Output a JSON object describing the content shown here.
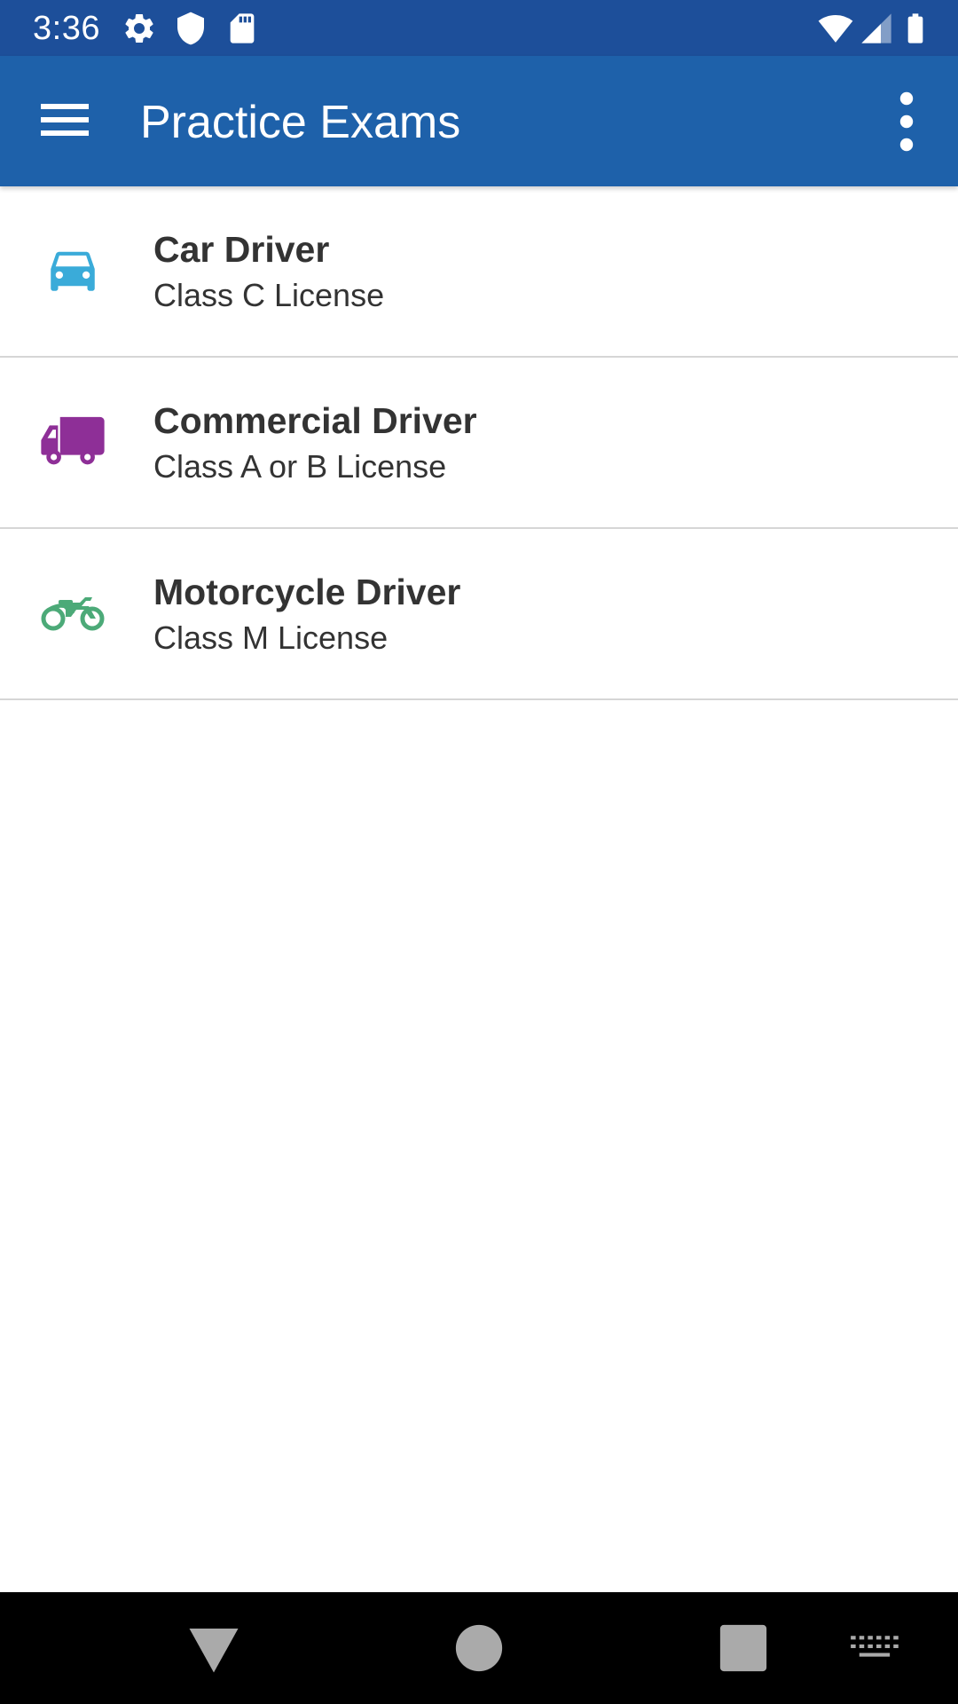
{
  "status_bar": {
    "time": "3:36",
    "left_icons": [
      "gear-icon",
      "shield-icon",
      "sd-card-icon"
    ],
    "right_icons": [
      "wifi-icon",
      "cell-signal-icon",
      "battery-icon"
    ]
  },
  "app_bar": {
    "title": "Practice Exams",
    "background": "#1e61aa",
    "status_background": "#1d4f9a"
  },
  "exams": [
    {
      "title": "Car Driver",
      "subtitle": "Class C License",
      "icon": "car-icon",
      "color": "#3aabd9"
    },
    {
      "title": "Commercial Driver",
      "subtitle": "Class A or B License",
      "icon": "truck-icon",
      "color": "#8e2f97"
    },
    {
      "title": "Motorcycle Driver",
      "subtitle": "Class M License",
      "icon": "motorcycle-icon",
      "color": "#4caa78"
    }
  ],
  "nav_bar": {
    "buttons": [
      "back-icon",
      "home-icon",
      "recents-icon",
      "keyboard-icon"
    ]
  }
}
